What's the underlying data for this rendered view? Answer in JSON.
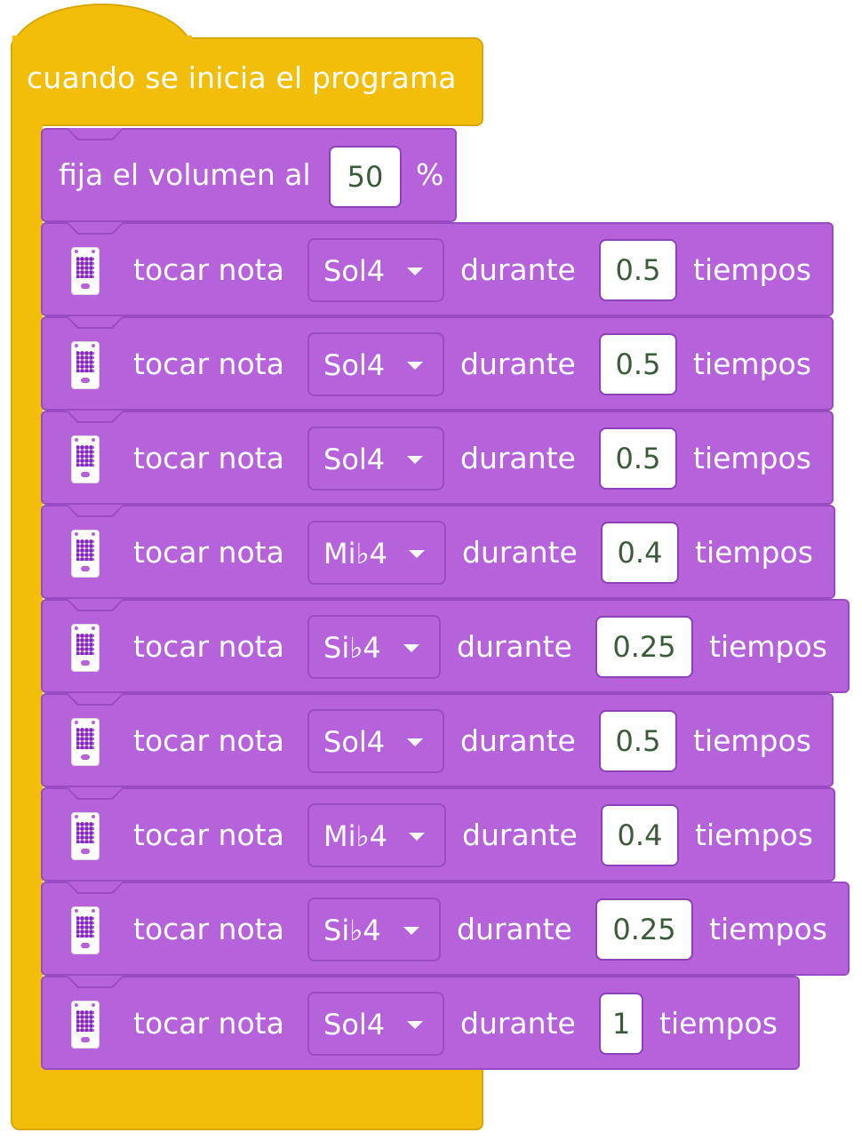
{
  "event_block": {
    "label": "cuando se inicia el programa"
  },
  "volume_block": {
    "label": "fija el volumen al",
    "value": "50",
    "unit": "%"
  },
  "note_blocks": [
    {
      "prefix": "tocar nota",
      "note": "Sol4",
      "during": "durante",
      "beats": "0.5",
      "suffix": "tiempos"
    },
    {
      "prefix": "tocar nota",
      "note": "Sol4",
      "during": "durante",
      "beats": "0.5",
      "suffix": "tiempos"
    },
    {
      "prefix": "tocar nota",
      "note": "Sol4",
      "during": "durante",
      "beats": "0.5",
      "suffix": "tiempos"
    },
    {
      "prefix": "tocar nota",
      "note": "Mi♭4",
      "during": "durante",
      "beats": "0.4",
      "suffix": "tiempos"
    },
    {
      "prefix": "tocar nota",
      "note": "Si♭4",
      "during": "durante",
      "beats": "0.25",
      "suffix": "tiempos"
    },
    {
      "prefix": "tocar nota",
      "note": "Sol4",
      "during": "durante",
      "beats": "0.5",
      "suffix": "tiempos"
    },
    {
      "prefix": "tocar nota",
      "note": "Mi♭4",
      "during": "durante",
      "beats": "0.4",
      "suffix": "tiempos"
    },
    {
      "prefix": "tocar nota",
      "note": "Si♭4",
      "during": "durante",
      "beats": "0.25",
      "suffix": "tiempos"
    },
    {
      "prefix": "tocar nota",
      "note": "Sol4",
      "during": "durante",
      "beats": "1",
      "suffix": "tiempos"
    }
  ],
  "icons": {
    "block_icon": "microbit-icon",
    "dropdown_icon": "caret-down-icon"
  },
  "colors": {
    "event": "#F2BE0A",
    "sound": "#B562DB"
  }
}
